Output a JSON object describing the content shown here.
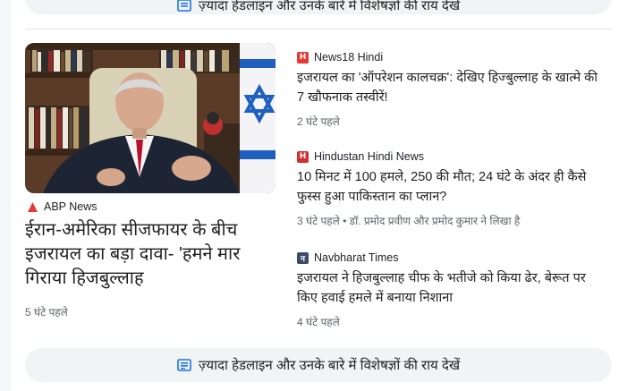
{
  "top_more_link": {
    "label": "ज़्यादा हेडलाइन और उनके बारे में विशेषज्ञों की राय देखें"
  },
  "hero": {
    "source": "ABP News",
    "source_color": "#e53935",
    "title": "ईरान-अमेरिका सीजफायर के बीच इजरायल का बड़ा दावा- 'हमने मार गिराया हिजबुल्लाह",
    "time": "5 घंटे पहले"
  },
  "stories": [
    {
      "source": "News18 Hindi",
      "logo_letter": "H",
      "logo_color": "#e53935",
      "title": "इजरायल का 'ऑपरेशन कालचक्र': देखिए हिज्बुल्लाह के खात्मे की 7 खौफनाक तस्वीरें!",
      "meta": "2 घंटे पहले"
    },
    {
      "source": "Hindustan Hindi News",
      "logo_letter": "H",
      "logo_color": "#d32f2f",
      "title": "10 मिनट में 100 हमले, 250 की मौत; 24 घंटे के अंदर ही कैसे फुस्स हुआ पाकिस्तान का प्लान?",
      "meta": "3 घंटे पहले • डॉ. प्रमोद प्रवीण और प्रमोद कुमार ने लिखा है"
    },
    {
      "source": "Navbharat Times",
      "logo_letter": "न",
      "logo_color": "#3c4a6b",
      "title": "इजरायल ने हिजबुल्लाह चीफ के भतीजे को किया ढेर, बेरूत पर किए हवाई हमले में बनाया निशाना",
      "meta": "4 घंटे पहले"
    }
  ],
  "more_link": {
    "label": "ज़्यादा हेडलाइन और उनके बारे में विशेषज्ञों की राय देखें"
  }
}
